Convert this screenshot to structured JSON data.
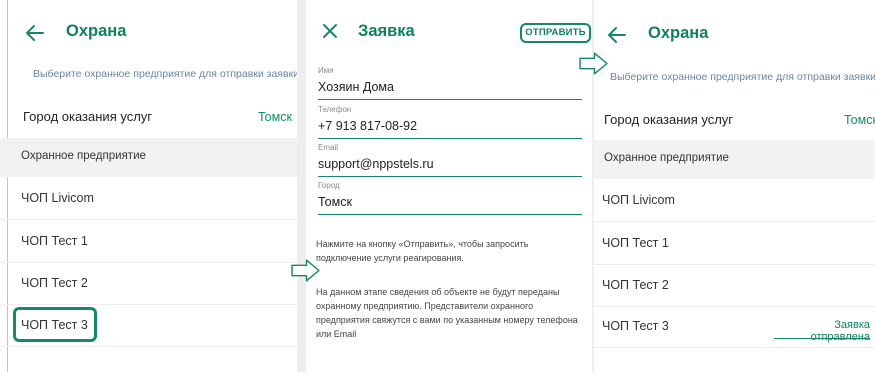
{
  "colors": {
    "accent": "#17876a",
    "title": "#10805f",
    "subtitle": "#6a86a2",
    "section_bg": "#f2f2f2"
  },
  "screen1": {
    "title": "Охрана",
    "subtitle": "Выберите охранное предприятие для отправки заявки",
    "city_label": "Город оказания услуг",
    "city_value": "Томск",
    "section_title": "Охранное предприятие",
    "items": [
      {
        "label": "ЧОП Livicom"
      },
      {
        "label": "ЧОП Тест 1"
      },
      {
        "label": "ЧОП Тест 2"
      },
      {
        "label": "ЧОП Тест 3"
      }
    ]
  },
  "screen2": {
    "title": "Заявка",
    "send_label": "ОТПРАВИТЬ",
    "fields": [
      {
        "label": "Имя",
        "value": "Хозяин Дома"
      },
      {
        "label": "Телефон",
        "value": "+7 913 817-08-92"
      },
      {
        "label": "Email",
        "value": "support@nppstels.ru"
      },
      {
        "label": "Город",
        "value": "Томск"
      }
    ],
    "info1": "Нажмите на кнопку «Отправить», чтобы запросить подключение услуги реагирования.",
    "info2": "На данном этапе сведения об объекте не будут переданы охранному предприятию. Представители охранного предприятия свяжутся с вами по указанным номеру телефона или Email"
  },
  "screen3": {
    "title": "Охрана",
    "subtitle": "Выберите охранное предприятие для отправки заявки",
    "city_label": "Город оказания услуг",
    "city_value": "Томск",
    "section_title": "Охранное предприятие",
    "items": [
      {
        "label": "ЧОП Livicom"
      },
      {
        "label": "ЧОП Тест 1"
      },
      {
        "label": "ЧОП Тест 2"
      },
      {
        "label": "ЧОП Тест 3"
      }
    ],
    "sent_label": "Заявка отправлена"
  },
  "icons": [
    "back-arrow-icon",
    "close-icon",
    "flow-arrow-icon"
  ]
}
